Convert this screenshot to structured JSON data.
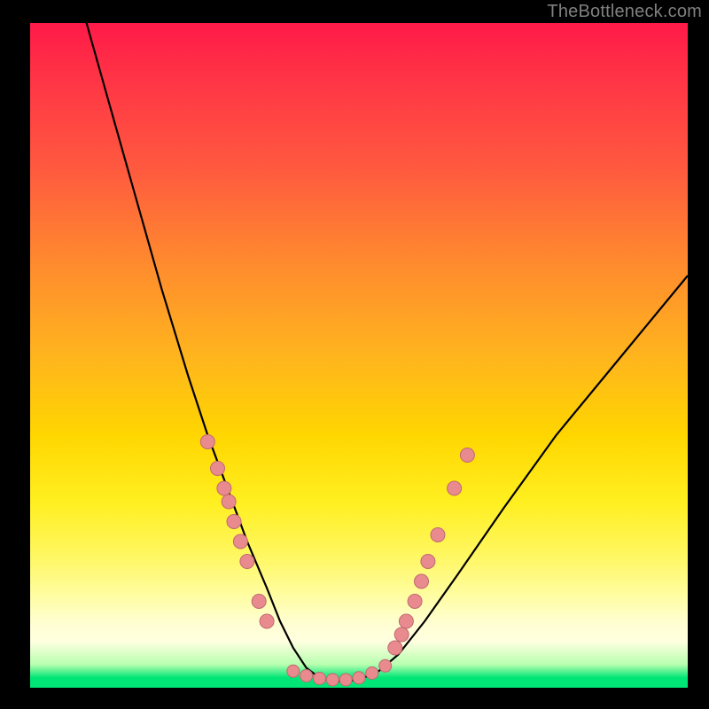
{
  "watermark": {
    "text": "TheBottleneck.com"
  },
  "chart_data": {
    "type": "line",
    "title": "",
    "xlabel": "",
    "ylabel": "",
    "xlim": [
      0,
      100
    ],
    "ylim": [
      0,
      100
    ],
    "series": [
      {
        "name": "bottleneck-curve",
        "x": [
          8,
          12,
          16,
          20,
          24,
          27,
          30,
          33,
          36,
          38,
          40,
          42,
          44,
          46,
          48,
          50,
          53,
          56,
          60,
          65,
          72,
          80,
          90,
          100
        ],
        "y": [
          102,
          88,
          74,
          60,
          47,
          38,
          30,
          22,
          15,
          10,
          6,
          3,
          1.5,
          1,
          1,
          1.2,
          2.5,
          5,
          10,
          17,
          27,
          38,
          50,
          62
        ]
      }
    ],
    "markers_left": {
      "name": "dots-descending",
      "x": [
        27.0,
        28.5,
        29.5,
        30.2,
        31.0,
        32.0,
        33.0,
        34.8,
        36.0
      ],
      "y": [
        37,
        33,
        30,
        28,
        25,
        22,
        19,
        13,
        10
      ]
    },
    "markers_right": {
      "name": "dots-ascending",
      "x": [
        55.5,
        56.5,
        57.2,
        58.5,
        59.5,
        60.5,
        62.0,
        64.5,
        66.5
      ],
      "y": [
        6,
        8,
        10,
        13,
        16,
        19,
        23,
        30,
        35
      ]
    },
    "markers_bottom": {
      "name": "dots-valley",
      "x": [
        40,
        42,
        44,
        46,
        48,
        50,
        52,
        54
      ],
      "y": [
        2.5,
        1.8,
        1.4,
        1.2,
        1.2,
        1.5,
        2.2,
        3.3
      ]
    },
    "colors": {
      "curve": "#000000",
      "marker_fill": "#e98a8f",
      "marker_stroke": "#c06a70"
    }
  }
}
